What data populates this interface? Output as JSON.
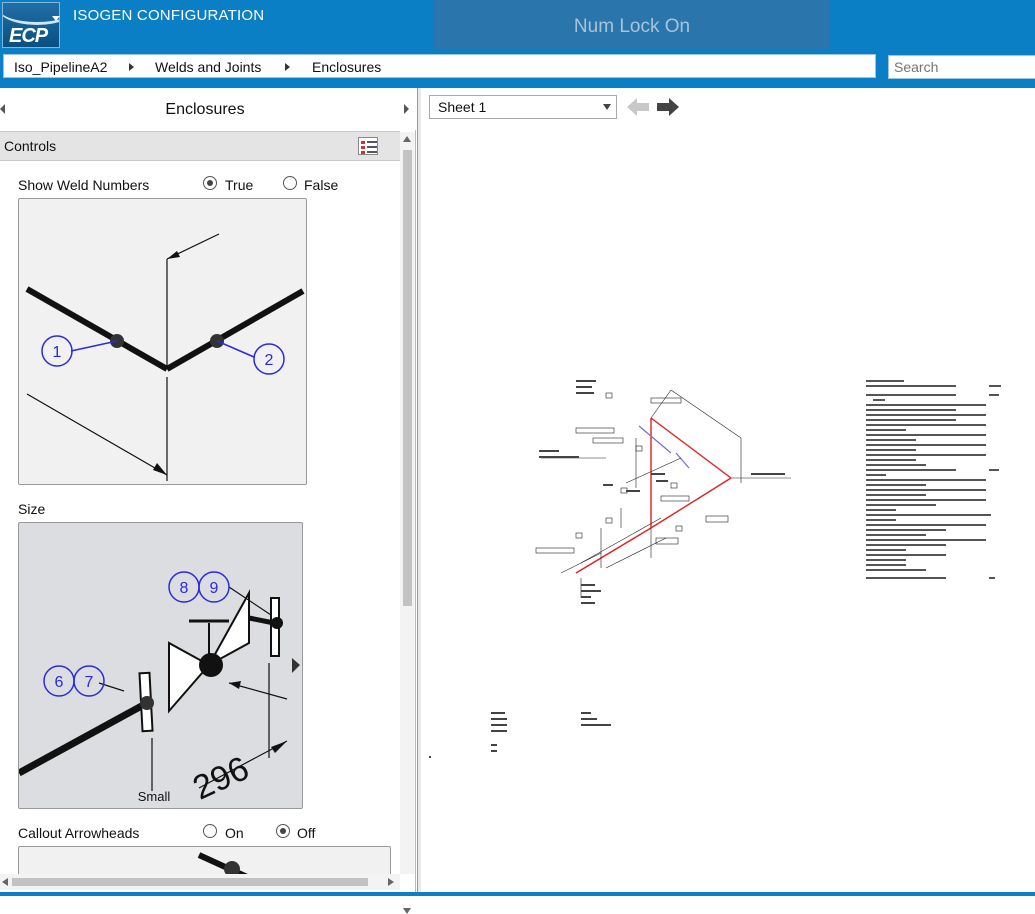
{
  "app": {
    "logo_text": "ECP",
    "title": "ISOGEN CONFIGURATION",
    "toast": "Num Lock On"
  },
  "breadcrumb": [
    "Iso_PipelineA2",
    "Welds and Joints",
    "Enclosures"
  ],
  "search": {
    "placeholder": "Search"
  },
  "left_panel": {
    "title": "Enclosures",
    "section": "Controls",
    "options": [
      {
        "label": "Show Weld Numbers",
        "choices": [
          "True",
          "False"
        ],
        "selected": "True"
      },
      {
        "label": "Size",
        "value": "Small"
      },
      {
        "label": "Callout Arrowheads",
        "choices": [
          "On",
          "Off"
        ],
        "selected": "Off"
      }
    ],
    "preview1": {
      "bubbles": [
        "1",
        "2"
      ]
    },
    "preview2": {
      "bubbles": [
        "8",
        "9",
        "6",
        "7"
      ],
      "dimension": "296",
      "caption": "Small"
    }
  },
  "right_panel": {
    "sheet": "Sheet 1"
  },
  "colors": {
    "accent": "#0a7fc6",
    "bubble": "#2a2ae0",
    "pipe": "#e02020"
  },
  "icons": [
    "controls-list-icon",
    "back-arrow-icon",
    "forward-arrow-icon",
    "dropdown-caret-icon"
  ]
}
